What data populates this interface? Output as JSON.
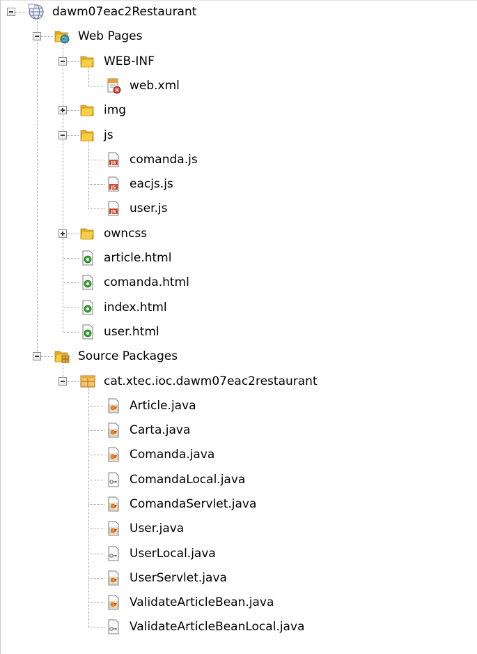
{
  "project_tree": {
    "nodes": [
      {
        "label": "dawm07eac2Restaurant",
        "icon": "project-globe-icon",
        "depth": 0,
        "expandable": true,
        "expanded": true
      },
      {
        "label": "Web Pages",
        "icon": "web-pages-folder-icon",
        "depth": 1,
        "expandable": true,
        "expanded": true
      },
      {
        "label": "WEB-INF",
        "icon": "folder-icon",
        "depth": 2,
        "expandable": true,
        "expanded": true
      },
      {
        "label": "web.xml",
        "icon": "xml-file-error-icon",
        "depth": 3,
        "expandable": false,
        "expanded": false
      },
      {
        "label": "img",
        "icon": "folder-icon",
        "depth": 2,
        "expandable": true,
        "expanded": false
      },
      {
        "label": "js",
        "icon": "folder-icon",
        "depth": 2,
        "expandable": true,
        "expanded": true
      },
      {
        "label": "comanda.js",
        "icon": "javascript-file-icon",
        "depth": 3,
        "expandable": false,
        "expanded": false
      },
      {
        "label": "eacjs.js",
        "icon": "javascript-file-icon",
        "depth": 3,
        "expandable": false,
        "expanded": false
      },
      {
        "label": "user.js",
        "icon": "javascript-file-icon",
        "depth": 3,
        "expandable": false,
        "expanded": false
      },
      {
        "label": "owncss",
        "icon": "folder-icon",
        "depth": 2,
        "expandable": true,
        "expanded": false
      },
      {
        "label": "article.html",
        "icon": "html-file-icon",
        "depth": 2,
        "expandable": false,
        "expanded": false
      },
      {
        "label": "comanda.html",
        "icon": "html-file-icon",
        "depth": 2,
        "expandable": false,
        "expanded": false
      },
      {
        "label": "index.html",
        "icon": "html-file-icon",
        "depth": 2,
        "expandable": false,
        "expanded": false
      },
      {
        "label": "user.html",
        "icon": "html-file-icon",
        "depth": 2,
        "expandable": false,
        "expanded": false
      },
      {
        "label": "Source Packages",
        "icon": "source-packages-folder-icon",
        "depth": 1,
        "expandable": true,
        "expanded": true
      },
      {
        "label": "cat.xtec.ioc.dawm07eac2restaurant",
        "icon": "java-package-icon",
        "depth": 2,
        "expandable": true,
        "expanded": true
      },
      {
        "label": "Article.java",
        "icon": "java-class-file-icon",
        "depth": 3,
        "expandable": false,
        "expanded": false
      },
      {
        "label": "Carta.java",
        "icon": "java-class-file-icon",
        "depth": 3,
        "expandable": false,
        "expanded": false
      },
      {
        "label": "Comanda.java",
        "icon": "java-class-file-icon",
        "depth": 3,
        "expandable": false,
        "expanded": false
      },
      {
        "label": "ComandaLocal.java",
        "icon": "java-interface-file-icon",
        "depth": 3,
        "expandable": false,
        "expanded": false
      },
      {
        "label": "ComandaServlet.java",
        "icon": "java-class-file-icon",
        "depth": 3,
        "expandable": false,
        "expanded": false
      },
      {
        "label": "User.java",
        "icon": "java-class-file-icon",
        "depth": 3,
        "expandable": false,
        "expanded": false
      },
      {
        "label": "UserLocal.java",
        "icon": "java-interface-file-icon",
        "depth": 3,
        "expandable": false,
        "expanded": false
      },
      {
        "label": "UserServlet.java",
        "icon": "java-class-file-icon",
        "depth": 3,
        "expandable": false,
        "expanded": false
      },
      {
        "label": "ValidateArticleBean.java",
        "icon": "java-class-file-icon",
        "depth": 3,
        "expandable": false,
        "expanded": false
      },
      {
        "label": "ValidateArticleBeanLocal.java",
        "icon": "java-interface-file-icon",
        "depth": 3,
        "expandable": false,
        "expanded": false
      }
    ]
  },
  "colors": {
    "background": "#ffffff",
    "tree_lines": "#9a9a9a",
    "folder_yellow": "#f2c12e",
    "html_badge_green": "#3aa33a",
    "js_badge_red": "#c94a2c",
    "java_badge_orange": "#e98a2a"
  }
}
